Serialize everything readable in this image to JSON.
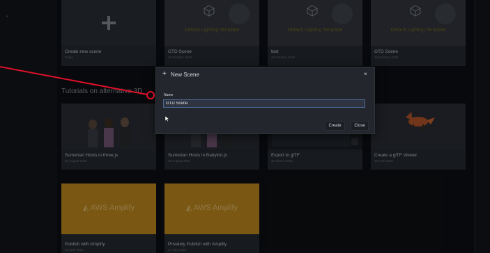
{
  "create_card": {
    "title": "Create new scene",
    "date": "Today"
  },
  "scenes": [
    {
      "thumb_text": "Default Lighting Template",
      "title": "GTD Scene",
      "date": "29 October 2020"
    },
    {
      "thumb_text": "Default Lighting Template",
      "title": "test",
      "date": "28 October 2020"
    },
    {
      "thumb_text": "Default Lighting Template",
      "title": "GTD Scene",
      "date": "23 October 2020"
    }
  ],
  "tutorials_heading": "Tutorials on alternative 3D",
  "tutorials": [
    {
      "title": "Sumerian Hosts in three.js",
      "date": "30 August 2020"
    },
    {
      "title": "Sumerian Hosts in Babylon.js",
      "date": "30 August 2020"
    },
    {
      "title": "Export to glTF",
      "date": "30 March 2020"
    },
    {
      "title": "Create a glTF Viewer",
      "date": "20 April 2020"
    },
    {
      "thumb_text": "AWS Amplify",
      "title": "Publish with Amplify",
      "date": "20 April 2020"
    },
    {
      "thumb_text": "AWS Amplify",
      "title": "Privately Publish with Amplify",
      "date": "17 July 2020"
    }
  ],
  "modal": {
    "title": "New Scene",
    "plus_icon": "+",
    "close_icon": "×",
    "name_label": "Name",
    "name_value": "GTD Scene",
    "create_label": "Create",
    "close_label": "Close"
  },
  "colors": {
    "annotation": "#e0102a",
    "amplify": "#c58d1f",
    "input_border": "#4a6a9a"
  }
}
